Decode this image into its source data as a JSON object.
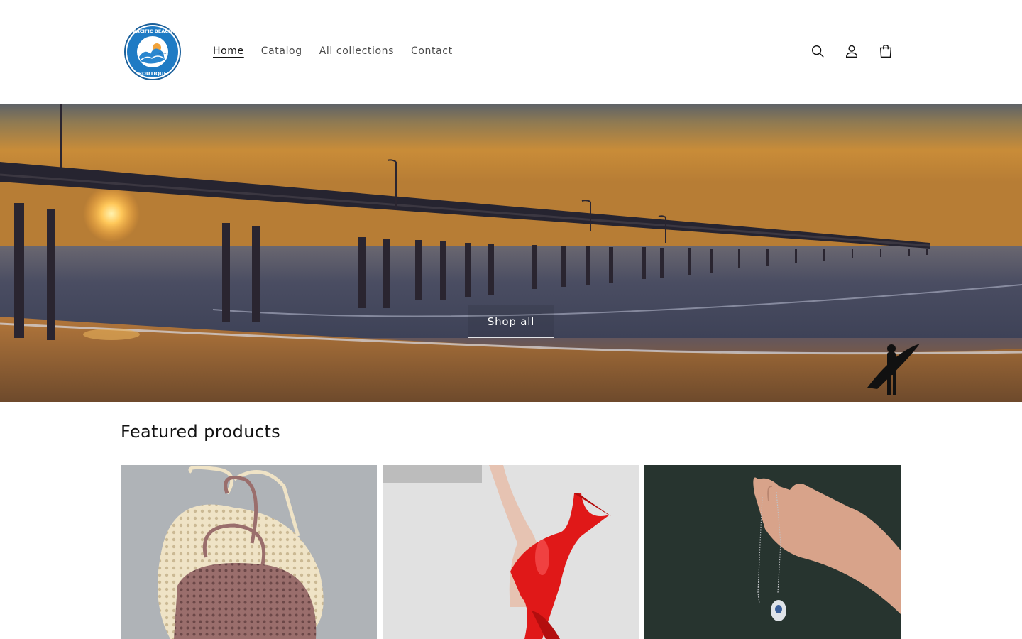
{
  "header": {
    "logo_text_top": "PACIFIC BEACH",
    "logo_text_bottom": "BOUTIQUE",
    "logo_est": "EST. 2021",
    "nav": [
      {
        "label": "Home",
        "active": true
      },
      {
        "label": "Catalog",
        "active": false
      },
      {
        "label": "All collections",
        "active": false
      },
      {
        "label": "Contact",
        "active": false
      }
    ],
    "icons": [
      "search-icon",
      "account-icon",
      "cart-icon"
    ]
  },
  "hero": {
    "button_label": "Shop all"
  },
  "featured": {
    "title": "Featured products",
    "products": [
      {
        "image": "crochet-bags"
      },
      {
        "image": "red-heels"
      },
      {
        "image": "pendant-necklace"
      }
    ]
  },
  "colors": {
    "logo_blue": "#1f7bc4",
    "sunset_orange": "#c98a33",
    "heel_red": "#e01818"
  }
}
